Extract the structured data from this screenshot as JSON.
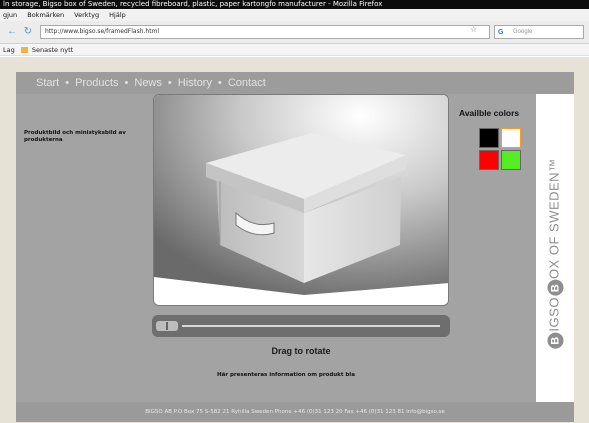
{
  "browser": {
    "title": "ln storage, Bigso box of Sweden, recycled fibreboard, plastic, paper kartongfo manufacturer - Mozilla Firefox",
    "menu": [
      "gjun",
      "Bokmärken",
      "Verktyg",
      "Hjälp"
    ],
    "url": "http://www.bigso.se/framedFlash.html",
    "search_placeholder": "Google",
    "bookmarks": [
      "Lag",
      "Senaste nytt"
    ]
  },
  "site": {
    "nav": [
      "Start",
      "Products",
      "News",
      "History",
      "Contact"
    ],
    "left_text": "Produktbild och ministyksbild av produkterna",
    "drag_label": "Drag to rotate",
    "info_text": "Här presenteras information om produkt bla",
    "colors_title": "Availble colors",
    "swatches": [
      "#000000",
      "#ffffff",
      "#ff0000",
      "#55ee22"
    ],
    "brand_prefix": "B",
    "brand_mid1": "IGSO",
    "brand_mid2": "B",
    "brand_mid3": "OX OF SWEDEN™",
    "footer": "BIGSO AB P.O Box 75 S-582 21 Ryhilla Sweden Phone +46 (0)31 123 20 Fax +46 (0)31 123 81 info@bigso.se"
  }
}
